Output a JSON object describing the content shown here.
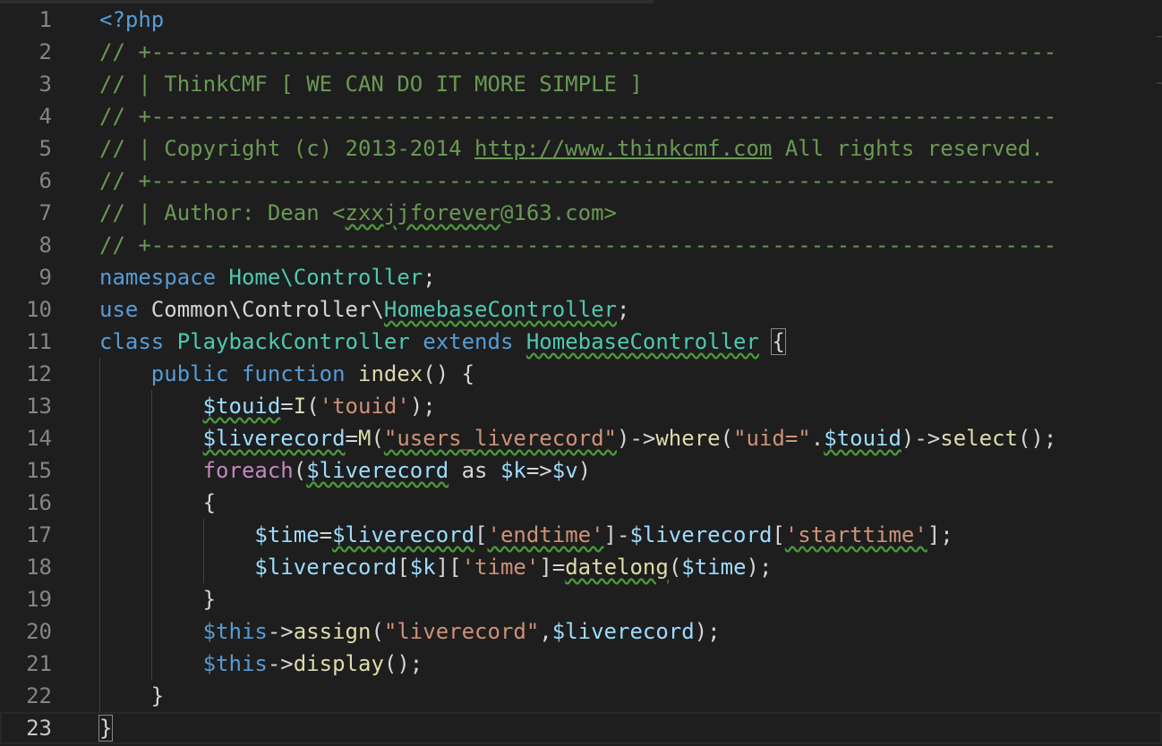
{
  "editor": {
    "language": "php",
    "cursor_line": 23,
    "colors": {
      "background": "#1e1e1e",
      "keyword": "#569cd6",
      "control": "#c586c0",
      "type": "#4ec9b0",
      "string": "#ce9178",
      "function": "#dcdcaa",
      "variable": "#9cdcfe",
      "comment": "#6a9955",
      "line_number": "#858585"
    },
    "line_numbers": [
      "1",
      "2",
      "3",
      "4",
      "5",
      "6",
      "7",
      "8",
      "9",
      "10",
      "11",
      "12",
      "13",
      "14",
      "15",
      "16",
      "17",
      "18",
      "19",
      "20",
      "21",
      "22",
      "23"
    ],
    "lines": [
      [
        {
          "t": "<?php",
          "c": "kw"
        }
      ],
      [
        {
          "t": "// +----------------------------------------------------------------------",
          "c": "cm"
        }
      ],
      [
        {
          "t": "// | ThinkCMF [ WE CAN DO IT MORE SIMPLE ]",
          "c": "cm"
        }
      ],
      [
        {
          "t": "// +----------------------------------------------------------------------",
          "c": "cm"
        }
      ],
      [
        {
          "t": "// | Copyright (c) 2013-2014 ",
          "c": "cm"
        },
        {
          "t": "http://www.thinkcmf.com",
          "c": "cm ul"
        },
        {
          "t": " All rights reserved.",
          "c": "cm"
        }
      ],
      [
        {
          "t": "// +----------------------------------------------------------------------",
          "c": "cm"
        }
      ],
      [
        {
          "t": "// | Author: Dean <",
          "c": "cm"
        },
        {
          "t": "zxxjjforever",
          "c": "cm sq"
        },
        {
          "t": "@163.com>",
          "c": "cm"
        }
      ],
      [
        {
          "t": "// +----------------------------------------------------------------------",
          "c": "cm"
        }
      ],
      [
        {
          "t": "namespace",
          "c": "kw"
        },
        {
          "t": " "
        },
        {
          "t": "Home\\Controller",
          "c": "cls"
        },
        {
          "t": ";"
        }
      ],
      [
        {
          "t": "use",
          "c": "kw"
        },
        {
          "t": " Common\\Controller\\"
        },
        {
          "t": "HomebaseController",
          "c": "cls sq"
        },
        {
          "t": ";"
        }
      ],
      [
        {
          "t": "class",
          "c": "kw"
        },
        {
          "t": " "
        },
        {
          "t": "PlaybackController",
          "c": "cls"
        },
        {
          "t": " "
        },
        {
          "t": "extends",
          "c": "kw"
        },
        {
          "t": " "
        },
        {
          "t": "HomebaseController",
          "c": "cls sq"
        },
        {
          "t": " "
        },
        {
          "t": "{",
          "c": "bm"
        }
      ],
      [
        {
          "t": "    "
        },
        {
          "t": "public",
          "c": "kw"
        },
        {
          "t": " "
        },
        {
          "t": "function",
          "c": "kw"
        },
        {
          "t": " "
        },
        {
          "t": "index",
          "c": "fn"
        },
        {
          "t": "() {"
        }
      ],
      [
        {
          "t": "        "
        },
        {
          "t": "$touid",
          "c": "var sq"
        },
        {
          "t": "="
        },
        {
          "t": "I",
          "c": "fn"
        },
        {
          "t": "("
        },
        {
          "t": "'touid'",
          "c": "str"
        },
        {
          "t": ");"
        }
      ],
      [
        {
          "t": "        "
        },
        {
          "t": "$liverecord",
          "c": "var sq"
        },
        {
          "t": "="
        },
        {
          "t": "M",
          "c": "fn"
        },
        {
          "t": "("
        },
        {
          "t": "\"users_liverecord\"",
          "c": "str sq"
        },
        {
          "t": ")->"
        },
        {
          "t": "where",
          "c": "fn"
        },
        {
          "t": "("
        },
        {
          "t": "\"uid=\"",
          "c": "str"
        },
        {
          "t": "."
        },
        {
          "t": "$touid",
          "c": "var sq"
        },
        {
          "t": ")->"
        },
        {
          "t": "select",
          "c": "fn"
        },
        {
          "t": "();"
        }
      ],
      [
        {
          "t": "        "
        },
        {
          "t": "foreach",
          "c": "ctrl"
        },
        {
          "t": "("
        },
        {
          "t": "$liverecord",
          "c": "var sq"
        },
        {
          "t": " as "
        },
        {
          "t": "$k",
          "c": "var"
        },
        {
          "t": "=>"
        },
        {
          "t": "$v",
          "c": "var"
        },
        {
          "t": ")"
        }
      ],
      [
        {
          "t": "        {"
        }
      ],
      [
        {
          "t": "            "
        },
        {
          "t": "$time",
          "c": "var"
        },
        {
          "t": "="
        },
        {
          "t": "$liverecord",
          "c": "var sq"
        },
        {
          "t": "["
        },
        {
          "t": "'endtime'",
          "c": "str sq"
        },
        {
          "t": "]-"
        },
        {
          "t": "$liverecord",
          "c": "var"
        },
        {
          "t": "["
        },
        {
          "t": "'starttime'",
          "c": "str sq"
        },
        {
          "t": "];"
        }
      ],
      [
        {
          "t": "            "
        },
        {
          "t": "$liverecord",
          "c": "var"
        },
        {
          "t": "["
        },
        {
          "t": "$k",
          "c": "var"
        },
        {
          "t": "]["
        },
        {
          "t": "'time'",
          "c": "str"
        },
        {
          "t": "]="
        },
        {
          "t": "datelong",
          "c": "fn sq"
        },
        {
          "t": "("
        },
        {
          "t": "$time",
          "c": "var"
        },
        {
          "t": ");"
        }
      ],
      [
        {
          "t": "        }"
        }
      ],
      [
        {
          "t": "        "
        },
        {
          "t": "$this",
          "c": "kw"
        },
        {
          "t": "->"
        },
        {
          "t": "assign",
          "c": "fn"
        },
        {
          "t": "("
        },
        {
          "t": "\"liverecord\"",
          "c": "str"
        },
        {
          "t": ","
        },
        {
          "t": "$liverecord",
          "c": "var"
        },
        {
          "t": ");"
        }
      ],
      [
        {
          "t": "        "
        },
        {
          "t": "$this",
          "c": "kw"
        },
        {
          "t": "->"
        },
        {
          "t": "display",
          "c": "fn"
        },
        {
          "t": "();"
        }
      ],
      [
        {
          "t": "    }"
        }
      ],
      [
        {
          "t": "}",
          "c": "bm"
        }
      ]
    ]
  }
}
